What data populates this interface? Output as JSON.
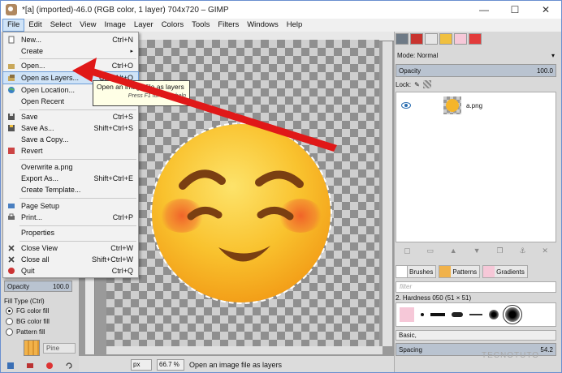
{
  "window": {
    "title": "*[a] (imported)-46.0 (RGB color, 1 layer) 704x720 – GIMP",
    "controls": {
      "minimize": "—",
      "maximize": "☐",
      "close": "✕"
    }
  },
  "menubar": {
    "items": [
      "File",
      "Edit",
      "Select",
      "View",
      "Image",
      "Layer",
      "Colors",
      "Tools",
      "Filters",
      "Windows",
      "Help"
    ]
  },
  "file_menu": {
    "items": [
      {
        "label": "New...",
        "shortcut": "Ctrl+N",
        "icon": "new-icon"
      },
      {
        "label": "Create",
        "shortcut": "",
        "icon": "",
        "submenu": "▸"
      },
      {
        "label": "Open...",
        "shortcut": "Ctrl+O",
        "icon": "open-folder-icon"
      },
      {
        "label": "Open as Layers...",
        "shortcut": "Ctrl+Alt+O",
        "icon": "open-layers-icon",
        "highlighted": true
      },
      {
        "label": "Open Location...",
        "shortcut": "",
        "icon": "globe-icon"
      },
      {
        "label": "Open Recent",
        "shortcut": "",
        "icon": ""
      },
      {
        "label": "Save",
        "shortcut": "Ctrl+S",
        "icon": "save-icon"
      },
      {
        "label": "Save As...",
        "shortcut": "Shift+Ctrl+S",
        "icon": "save-as-icon"
      },
      {
        "label": "Save a Copy...",
        "shortcut": "",
        "icon": ""
      },
      {
        "label": "Revert",
        "shortcut": "",
        "icon": "revert-icon"
      },
      {
        "label": "Overwrite a.png",
        "shortcut": "",
        "icon": ""
      },
      {
        "label": "Export As...",
        "shortcut": "Shift+Ctrl+E",
        "icon": ""
      },
      {
        "label": "Create Template...",
        "shortcut": "",
        "icon": ""
      },
      {
        "label": "Page Setup",
        "shortcut": "",
        "icon": "page-setup-icon"
      },
      {
        "label": "Print...",
        "shortcut": "Ctrl+P",
        "icon": "print-icon"
      },
      {
        "label": "Properties",
        "shortcut": "",
        "icon": ""
      },
      {
        "label": "Close View",
        "shortcut": "Ctrl+W",
        "icon": "close-view-icon"
      },
      {
        "label": "Close all",
        "shortcut": "Shift+Ctrl+W",
        "icon": "close-all-icon"
      },
      {
        "label": "Quit",
        "shortcut": "Ctrl+Q",
        "icon": "quit-icon"
      }
    ]
  },
  "tooltip": {
    "text": "Open an image file as layers",
    "hint": "Press F1 for more help"
  },
  "tool_options": {
    "opacity_label": "Opacity",
    "opacity_value": "100.0",
    "fill_type_label": "Fill Type  (Ctrl)",
    "fill_options": [
      "FG color fill",
      "BG color fill",
      "Pattern fill"
    ],
    "selected_fill": 0,
    "pattern_name": "Pine"
  },
  "statusbar": {
    "unit": "px",
    "zoom": "66.7 %",
    "message": "Open an image file as layers"
  },
  "layers_panel": {
    "mode_label": "Mode: Normal",
    "opacity_label": "Opacity",
    "opacity_value": "100.0",
    "lock_label": "Lock:",
    "layers": [
      {
        "name": "a.png"
      }
    ]
  },
  "brushes_panel": {
    "tabs": [
      "Brushes",
      "Patterns",
      "Gradients"
    ],
    "filter_placeholder": "filter",
    "brush_name": "2. Hardness 050 (51 × 51)",
    "preset": "Basic,",
    "spacing_label": "Spacing",
    "spacing_value": "54.2"
  },
  "watermark": "TECNOTUTO",
  "colors": {
    "menu_highlight": "#cfe3f7",
    "arrow": "#e01818",
    "emoji_yellow": "#f9c22e",
    "opacity_bar": "#b9c3d0"
  }
}
